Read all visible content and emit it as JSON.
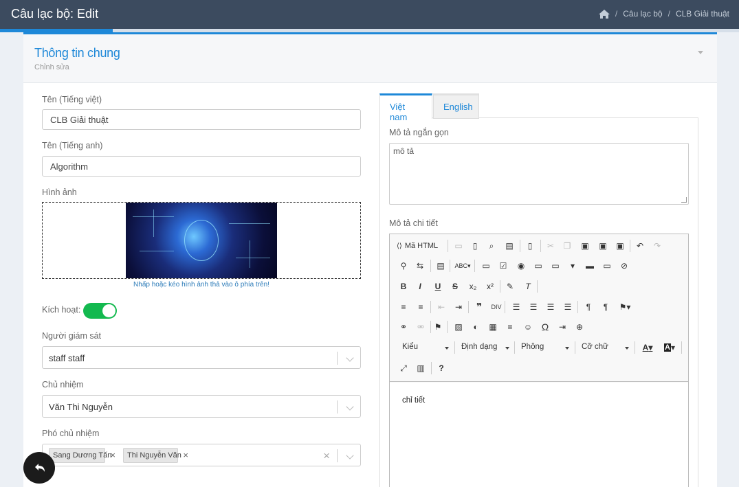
{
  "header": {
    "title": "Câu lạc bộ: Edit",
    "breadcrumb": [
      "Câu lạc bộ",
      "CLB Giải thuật"
    ]
  },
  "card": {
    "title": "Thông tin chung",
    "subtitle": "Chỉnh sửa"
  },
  "form": {
    "name_vi": {
      "label": "Tên (Tiếng việt)",
      "value": "CLB Giải thuật"
    },
    "name_en": {
      "label": "Tên (Tiếng anh)",
      "value": "Algorithm"
    },
    "image": {
      "label": "Hình ảnh",
      "hint": "Nhấp hoặc kéo hình ảnh thả vào ô phía trên!"
    },
    "active": {
      "label": "Kích hoạt:",
      "checked": true
    },
    "supervisor": {
      "label": "Người giám sát",
      "value": "staff staff"
    },
    "chairman": {
      "label": "Chủ nhiệm",
      "value": "Văn Thi Nguyễn"
    },
    "vice": {
      "label": "Phó chủ nhiệm",
      "tags": [
        "Sang Dương Tấn",
        "Thi Nguyễn Văn"
      ],
      "remove": "×",
      "clear": "×"
    }
  },
  "tabs": {
    "vi": "Việt nam",
    "en": "English"
  },
  "short_desc": {
    "label": "Mô tả ngắn gọn",
    "value": "mô tả"
  },
  "long_desc": {
    "label": "Mô tả chi tiết",
    "content": "chỉ tiết"
  },
  "editor": {
    "source_label": "Mã HTML",
    "combos": [
      "Kiểu",
      "Định dạng",
      "Phông",
      "Cỡ chữ"
    ],
    "icons": {
      "bold": "B",
      "italic": "I",
      "underline": "U",
      "strike": "S",
      "help": "?",
      "omega": "Ω",
      "quote": "❞",
      "text_color": "A"
    }
  },
  "colors": {
    "accent": "#1e88d8",
    "topbar": "#3c4b5f",
    "toggle": "#13b94f"
  }
}
